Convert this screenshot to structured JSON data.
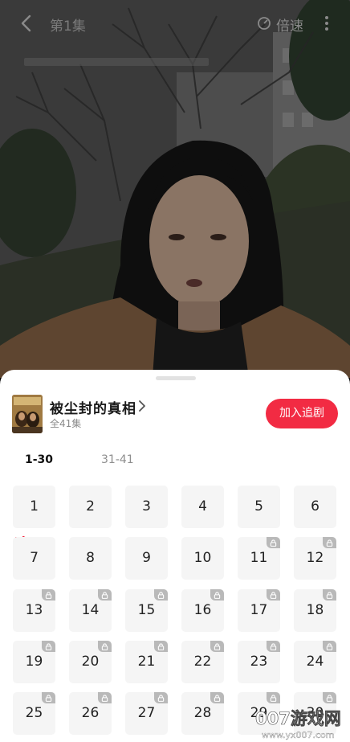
{
  "topbar": {
    "title": "第1集",
    "speed_label": "倍速"
  },
  "drama": {
    "title": "被尘封的真相",
    "episode_count": "全41集",
    "follow_label": "加入追剧"
  },
  "tabs": [
    {
      "label": "1-30",
      "active": true
    },
    {
      "label": "31-41",
      "active": false
    }
  ],
  "episodes": [
    {
      "num": "1",
      "locked": false,
      "playing": true
    },
    {
      "num": "2",
      "locked": false
    },
    {
      "num": "3",
      "locked": false
    },
    {
      "num": "4",
      "locked": false
    },
    {
      "num": "5",
      "locked": false
    },
    {
      "num": "6",
      "locked": false
    },
    {
      "num": "7",
      "locked": false
    },
    {
      "num": "8",
      "locked": false
    },
    {
      "num": "9",
      "locked": false
    },
    {
      "num": "10",
      "locked": false
    },
    {
      "num": "11",
      "locked": true
    },
    {
      "num": "12",
      "locked": true
    },
    {
      "num": "13",
      "locked": true
    },
    {
      "num": "14",
      "locked": true
    },
    {
      "num": "15",
      "locked": true
    },
    {
      "num": "16",
      "locked": true
    },
    {
      "num": "17",
      "locked": true
    },
    {
      "num": "18",
      "locked": true
    },
    {
      "num": "19",
      "locked": true
    },
    {
      "num": "20",
      "locked": true
    },
    {
      "num": "21",
      "locked": true
    },
    {
      "num": "22",
      "locked": true
    },
    {
      "num": "23",
      "locked": true
    },
    {
      "num": "24",
      "locked": true
    },
    {
      "num": "25",
      "locked": true
    },
    {
      "num": "26",
      "locked": true
    },
    {
      "num": "27",
      "locked": true
    },
    {
      "num": "28",
      "locked": true
    },
    {
      "num": "29",
      "locked": true
    },
    {
      "num": "30",
      "locked": true
    }
  ],
  "watermark": {
    "text": "007游戏网",
    "url": "www.yx007.com"
  },
  "colors": {
    "accent": "#f22b43",
    "tile_bg": "#f5f5f5",
    "lock_bg": "#b9b9b9"
  }
}
